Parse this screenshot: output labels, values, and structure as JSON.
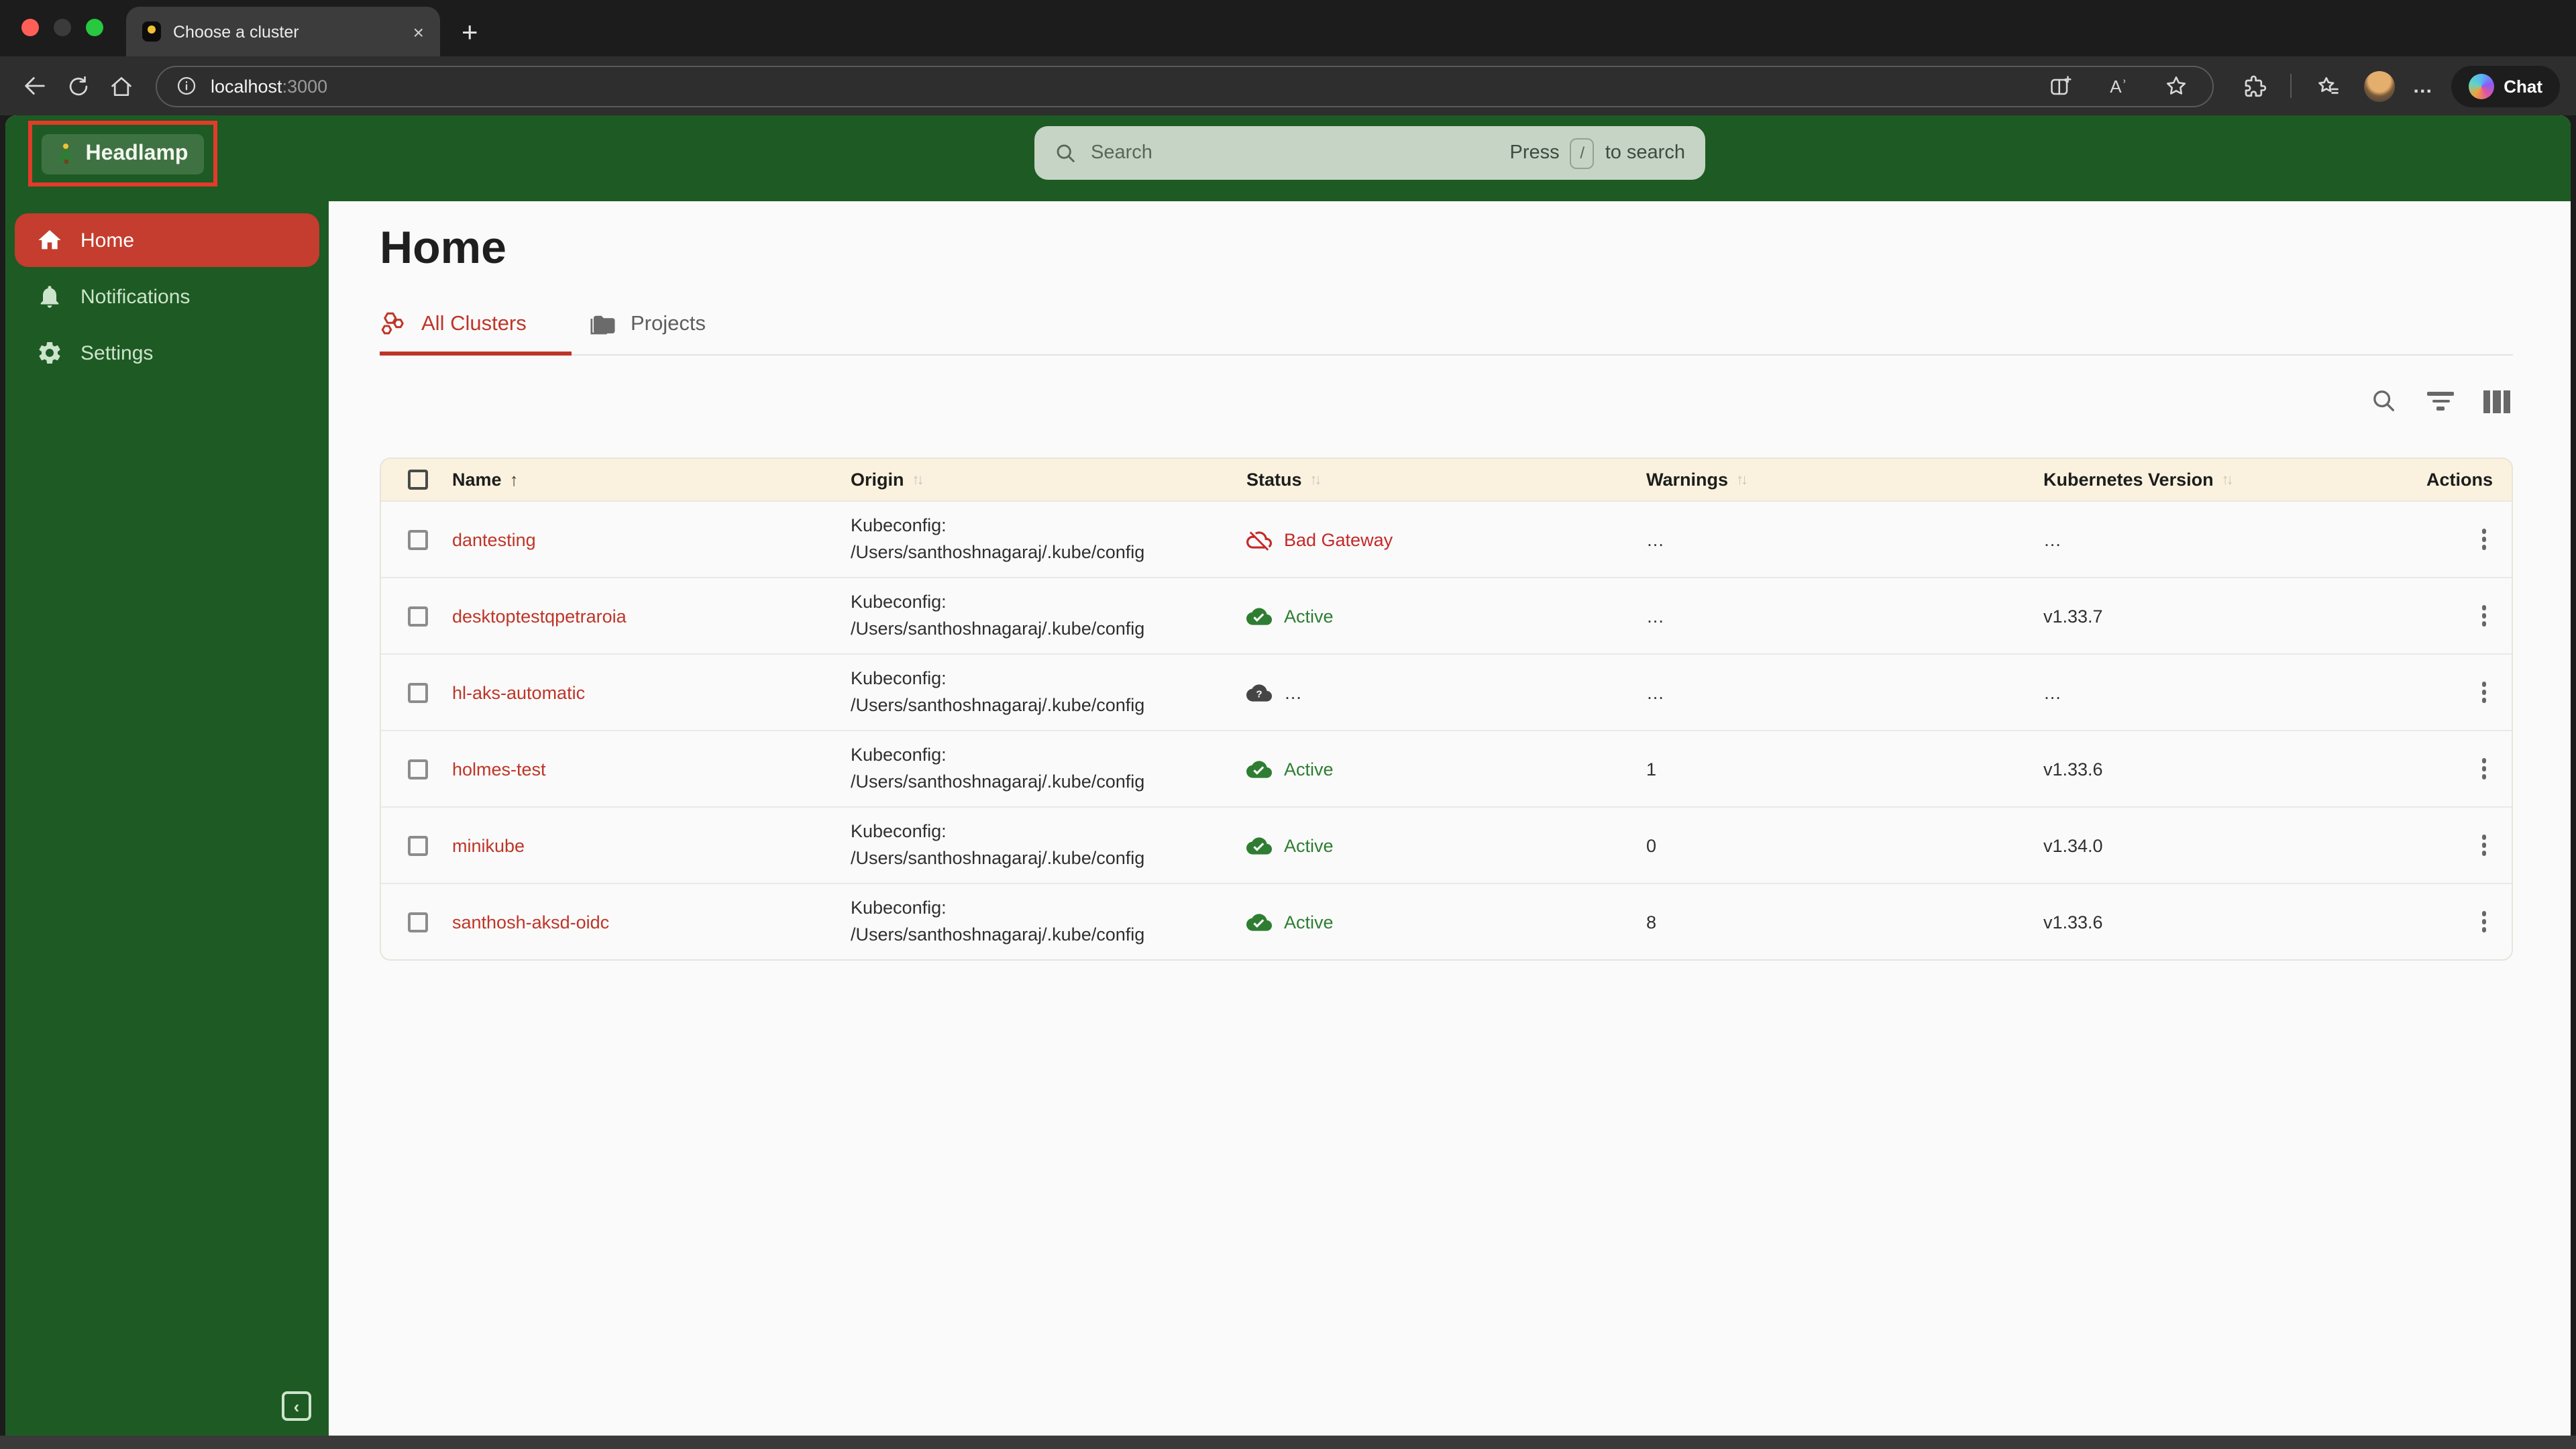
{
  "window": {
    "tab_title": "Choose a cluster",
    "close_tab_glyph": "×",
    "new_tab_glyph": "+"
  },
  "browser_toolbar": {
    "url_host": "localhost",
    "url_port": ":3000",
    "menu_dots": "…",
    "chat_label": "Chat",
    "read_aloud_glyph": "Aʾ"
  },
  "app_header": {
    "logo_emoji": "🎄",
    "logo_text": "Headlamp",
    "search_placeholder": "Search",
    "search_hint_prefix": "Press",
    "search_hint_key": "/",
    "search_hint_suffix": "to search"
  },
  "sidebar": {
    "items": [
      {
        "label": "Home",
        "icon": "home-icon",
        "selected": true
      },
      {
        "label": "Notifications",
        "icon": "bell-icon",
        "selected": false
      },
      {
        "label": "Settings",
        "icon": "gear-icon",
        "selected": false
      }
    ],
    "collapse_glyph": "‹"
  },
  "main": {
    "title": "Home",
    "tabs": [
      {
        "label": "All Clusters",
        "active": true
      },
      {
        "label": "Projects",
        "active": false
      }
    ],
    "table": {
      "columns": [
        "Name",
        "Origin",
        "Status",
        "Warnings",
        "Kubernetes Version",
        "Actions"
      ],
      "sort": {
        "column": "Name",
        "direction": "asc"
      },
      "sort_asc_glyph": "↑",
      "sort_both_glyph": "↑↓",
      "rows": [
        {
          "name": "dantesting",
          "origin_label": "Kubeconfig:",
          "origin_path": "/Users/santhoshnagaraj/.kube/config",
          "status": "Bad Gateway",
          "status_kind": "error",
          "warnings": "…",
          "version": "…"
        },
        {
          "name": "desktoptestqpetraroia",
          "origin_label": "Kubeconfig:",
          "origin_path": "/Users/santhoshnagaraj/.kube/config",
          "status": "Active",
          "status_kind": "active",
          "warnings": "…",
          "version": "v1.33.7"
        },
        {
          "name": "hl-aks-automatic",
          "origin_label": "Kubeconfig:",
          "origin_path": "/Users/santhoshnagaraj/.kube/config",
          "status": "…",
          "status_kind": "unknown",
          "warnings": "…",
          "version": "…"
        },
        {
          "name": "holmes-test",
          "origin_label": "Kubeconfig:",
          "origin_path": "/Users/santhoshnagaraj/.kube/config",
          "status": "Active",
          "status_kind": "active",
          "warnings": "1",
          "version": "v1.33.6"
        },
        {
          "name": "minikube",
          "origin_label": "Kubeconfig:",
          "origin_path": "/Users/santhoshnagaraj/.kube/config",
          "status": "Active",
          "status_kind": "active",
          "warnings": "0",
          "version": "v1.34.0"
        },
        {
          "name": "santhosh-aksd-oidc",
          "origin_label": "Kubeconfig:",
          "origin_path": "/Users/santhoshnagaraj/.kube/config",
          "status": "Active",
          "status_kind": "active",
          "warnings": "8",
          "version": "v1.33.6"
        }
      ]
    }
  },
  "colors": {
    "header_green": "#1e5a23",
    "sidebar_selected_red": "#c43d2e",
    "link_red": "#be3528",
    "status_active_green": "#2e7d32",
    "status_error_red": "#c62828",
    "table_header_cream": "#faf2de",
    "search_pill_sage": "#c5d4c4",
    "annotation_red": "#e23b29"
  }
}
